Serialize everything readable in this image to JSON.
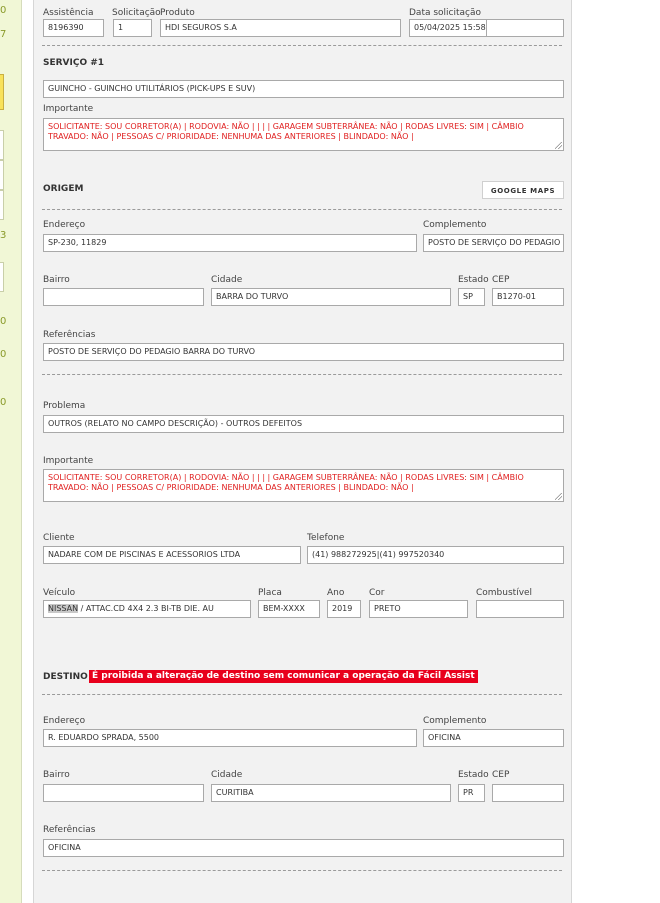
{
  "left_strip": {
    "numbers": [
      "0",
      "7",
      "3",
      "0",
      "0",
      "0"
    ]
  },
  "header": {
    "assistencia_label": "Assistência",
    "assistencia_value": "8196390",
    "solicitacao_label": "Solicitação",
    "solicitacao_value": "1",
    "produto_label": "Produto",
    "produto_value": "HDI SEGUROS S.A",
    "data_label": "Data solicitação",
    "data_value": "05/04/2025 15:58",
    "data_extra_value": ""
  },
  "servico": {
    "title": "SERVIÇO #1",
    "value": "GUINCHO - GUINCHO UTILITÁRIOS (PICK-UPS E SUV)",
    "importante_label": "Importante",
    "importante_text": "SOLICITANTE: SOU CORRETOR(A) | RODOVIA: NÃO |  |  |  | GARAGEM SUBTERRÂNEA: NÃO | RODAS LIVRES: SIM | CÂMBIO TRAVADO: NÃO | PESSOAS C/ PRIORIDADE: NENHUMA DAS ANTERIORES | BLINDADO: NÃO |"
  },
  "origem": {
    "title": "ORIGEM",
    "google_maps_label": "GOOGLE MAPS",
    "endereco_label": "Endereço",
    "endereco_value": "SP-230, 11829",
    "complemento_label": "Complemento",
    "complemento_value": "POSTO DE SERVIÇO DO PEDAGIO BA",
    "bairro_label": "Bairro",
    "bairro_value": "",
    "cidade_label": "Cidade",
    "cidade_value": "BARRA DO TURVO",
    "estado_label": "Estado",
    "estado_value": "SP",
    "cep_label": "CEP",
    "cep_value": "B1270-01",
    "referencias_label": "Referências",
    "referencias_value": "POSTO DE SERVIÇO DO PEDAGIO BARRA DO TURVO"
  },
  "problema": {
    "label": "Problema",
    "value": "OUTROS (RELATO NO CAMPO DESCRIÇÃO) - OUTROS DEFEITOS",
    "importante_label": "Importante",
    "importante_text": "SOLICITANTE: SOU CORRETOR(A) | RODOVIA: NÃO |  |  |  | GARAGEM SUBTERRÂNEA: NÃO | RODAS LIVRES: SIM | CÂMBIO TRAVADO: NÃO | PESSOAS C/ PRIORIDADE: NENHUMA DAS ANTERIORES | BLINDADO: NÃO |"
  },
  "cliente": {
    "cliente_label": "Cliente",
    "cliente_value": "NADARE COM DE PISCINAS E ACESSORIOS LTDA",
    "telefone_label": "Telefone",
    "telefone_value": "(41) 988272925|(41) 997520340"
  },
  "veiculo": {
    "veiculo_label": "Veículo",
    "veiculo_brand": "NISSAN",
    "veiculo_rest": " / ATTAC.CD 4X4 2.3 BI-TB DIE. AU",
    "placa_label": "Placa",
    "placa_value": "BEM-XXXX",
    "ano_label": "Ano",
    "ano_value": "2019",
    "cor_label": "Cor",
    "cor_value": "PRETO",
    "combustivel_label": "Combustível",
    "combustivel_value": ""
  },
  "destino": {
    "title": "DESTINO",
    "warning": "É proibida a alteração de destino sem comunicar a operação da Fácil Assist",
    "endereco_label": "Endereço",
    "endereco_value": "R. EDUARDO SPRADA, 5500",
    "complemento_label": "Complemento",
    "complemento_value": "OFICINA",
    "bairro_label": "Bairro",
    "bairro_value": "",
    "cidade_label": "Cidade",
    "cidade_value": "CURITIBA",
    "estado_label": "Estado",
    "estado_value": "PR",
    "cep_label": "CEP",
    "cep_value": "",
    "referencias_label": "Referências",
    "referencias_value": "OFICINA"
  },
  "colors": {
    "important_text": "#e02020",
    "warning_bg": "#e8001c",
    "panel_bg": "#f2f2f2",
    "strip_bg": "#f1f7d6"
  }
}
